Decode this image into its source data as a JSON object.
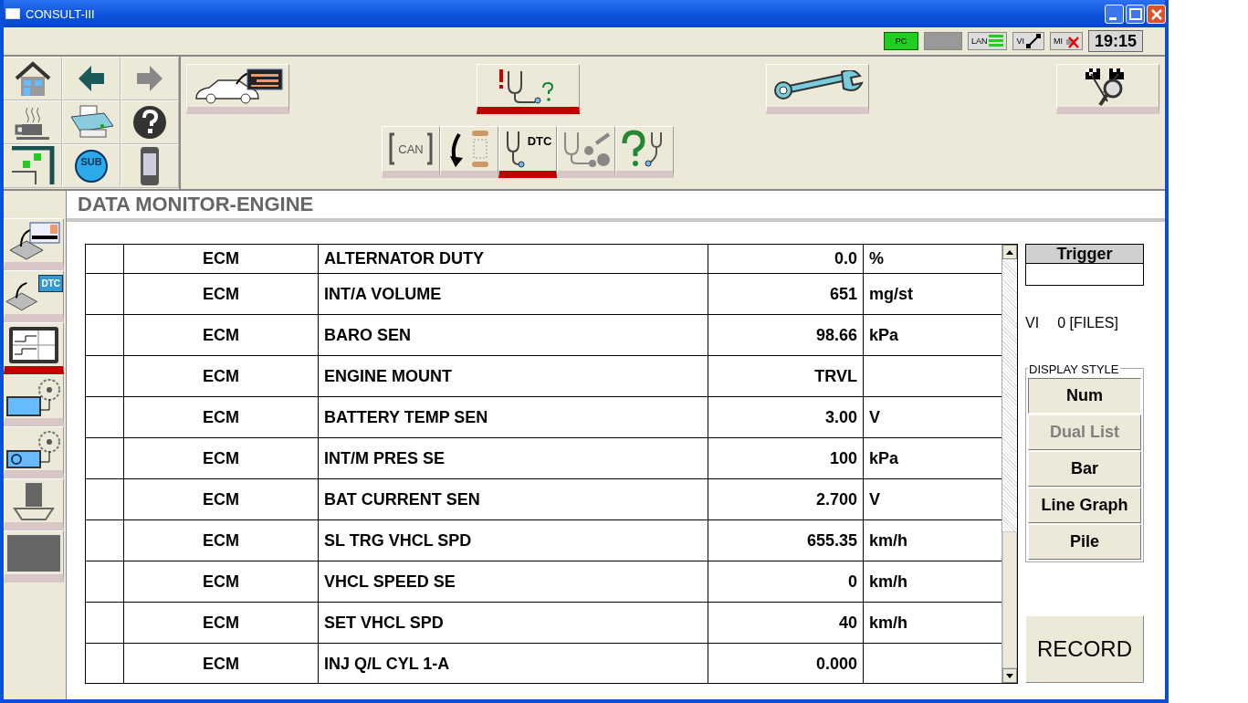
{
  "window": {
    "title": "CONSULT-III"
  },
  "status_bar": {
    "indicators": [
      {
        "kind": "pc",
        "label": "PC"
      },
      {
        "kind": "battery"
      },
      {
        "kind": "lan",
        "label": "LAN"
      },
      {
        "kind": "vi",
        "label": "VI"
      },
      {
        "kind": "mi",
        "label": "MI"
      }
    ],
    "time": "19:15"
  },
  "nav_grid": [
    {
      "kind": "home"
    },
    {
      "kind": "back"
    },
    {
      "kind": "forward"
    },
    {
      "kind": "coffee"
    },
    {
      "kind": "printer"
    },
    {
      "kind": "help"
    },
    {
      "kind": "resize"
    },
    {
      "kind": "sub",
      "label": "SUB"
    },
    {
      "kind": "phone"
    }
  ],
  "mode_buttons": [
    {
      "kind": "vehicle",
      "selected": false
    },
    {
      "kind": "diagnosis",
      "selected": true
    },
    {
      "kind": "wrench",
      "selected": false
    },
    {
      "kind": "flags",
      "selected": false
    }
  ],
  "sub_buttons": [
    {
      "kind": "can",
      "label": "CAN",
      "selected": false
    },
    {
      "kind": "flow",
      "selected": false
    },
    {
      "kind": "dtc",
      "label": "DTC",
      "selected": true
    },
    {
      "kind": "stetho",
      "selected": false
    },
    {
      "kind": "question",
      "selected": false
    }
  ],
  "sidebar": {
    "items": [
      {
        "kind": "ecu_id",
        "selected": false
      },
      {
        "kind": "ecu_dtc",
        "label": "DTC",
        "selected": false
      },
      {
        "kind": "monitor",
        "selected": true
      },
      {
        "kind": "fan",
        "selected": false
      },
      {
        "kind": "fan_cycle",
        "selected": false
      },
      {
        "kind": "seat",
        "selected": false
      },
      {
        "kind": "blank",
        "selected": false
      }
    ]
  },
  "page_title": "DATA MONITOR-ENGINE",
  "table": {
    "rows": [
      {
        "system": "ECM",
        "item": "ALTERNATOR DUTY",
        "value": "0.0",
        "unit": "%"
      },
      {
        "system": "ECM",
        "item": "INT/A VOLUME",
        "value": "651",
        "unit": "mg/st"
      },
      {
        "system": "ECM",
        "item": "BARO SEN",
        "value": "98.66",
        "unit": "kPa"
      },
      {
        "system": "ECM",
        "item": "ENGINE MOUNT",
        "value": "TRVL"
      },
      {
        "system": "ECM",
        "item": "BATTERY TEMP SEN",
        "value": "3.00",
        "unit": "V"
      },
      {
        "system": "ECM",
        "item": "INT/M PRES SE",
        "value": "100",
        "unit": "kPa"
      },
      {
        "system": "ECM",
        "item": "BAT CURRENT SEN",
        "value": "2.700",
        "unit": "V"
      },
      {
        "system": "ECM",
        "item": "SL TRG VHCL SPD",
        "value": "655.35",
        "unit": "km/h"
      },
      {
        "system": "ECM",
        "item": "VHCL SPEED SE",
        "value": "0",
        "unit": "km/h"
      },
      {
        "system": "ECM",
        "item": "SET VHCL SPD",
        "value": "40",
        "unit": "km/h"
      },
      {
        "system": "ECM",
        "item": "INJ Q/L CYL 1-A",
        "value": "0.000"
      }
    ]
  },
  "trigger": {
    "label": "Trigger"
  },
  "files": {
    "device": "VI",
    "count": "0 [FILES]"
  },
  "display_style": {
    "title": "DISPLAY STYLE",
    "buttons": [
      {
        "label": "Num",
        "selected": true,
        "disabled": false
      },
      {
        "label": "Dual List",
        "selected": false,
        "disabled": true
      },
      {
        "label": "Bar",
        "selected": false,
        "disabled": false
      },
      {
        "label": "Line Graph",
        "selected": false,
        "disabled": false
      },
      {
        "label": "Pile",
        "selected": false,
        "disabled": false
      }
    ]
  },
  "record": {
    "label": "RECORD"
  }
}
